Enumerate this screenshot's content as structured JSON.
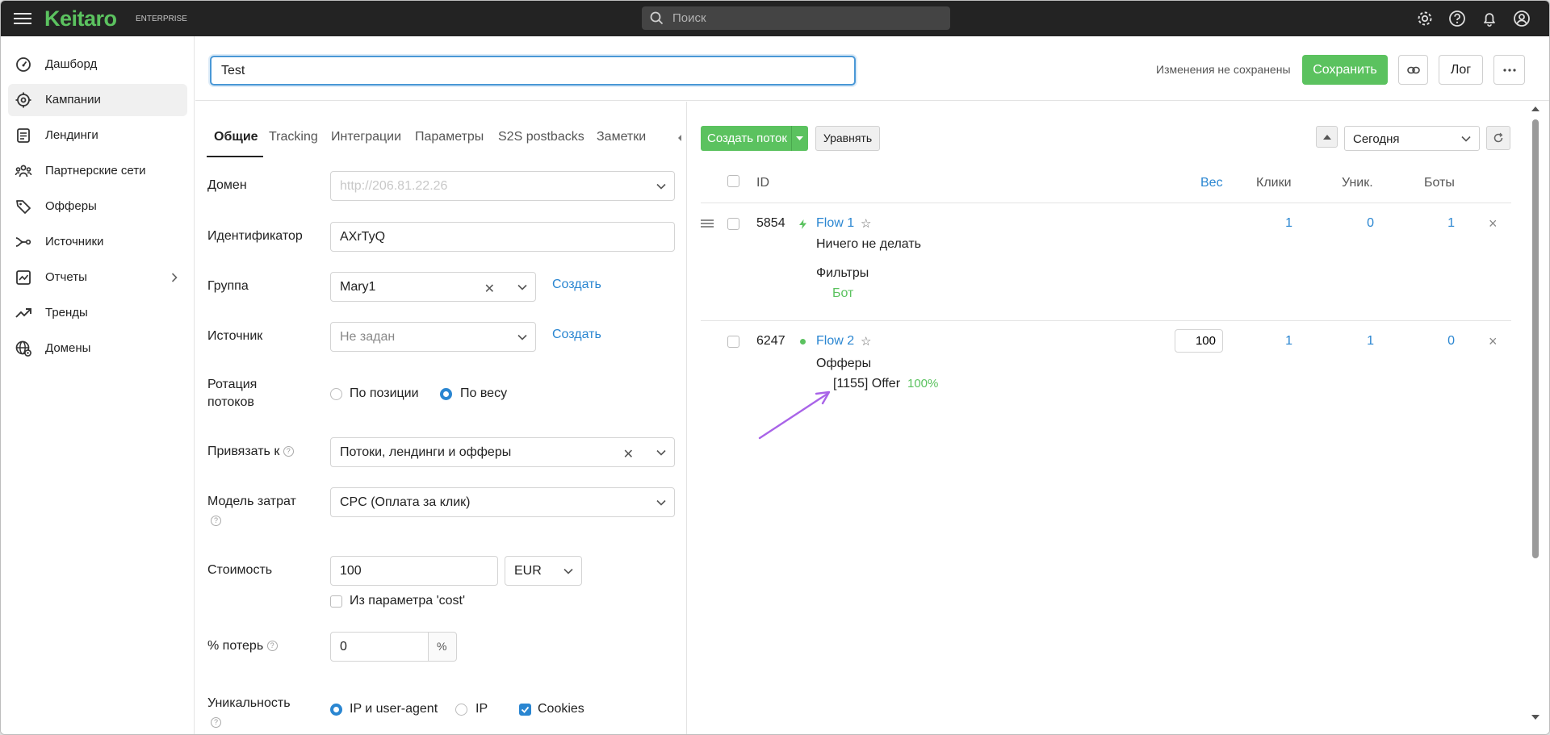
{
  "header": {
    "brand": "Keitaro",
    "edition": "ENTERPRISE",
    "search_placeholder": "Поиск"
  },
  "sidebar": {
    "items": [
      {
        "label": "Дашборд",
        "icon": "dashboard-icon"
      },
      {
        "label": "Кампании",
        "icon": "campaigns-icon",
        "active": true
      },
      {
        "label": "Лендинги",
        "icon": "landings-icon"
      },
      {
        "label": "Партнерские сети",
        "icon": "affiliate-networks-icon"
      },
      {
        "label": "Офферы",
        "icon": "offers-icon"
      },
      {
        "label": "Источники",
        "icon": "sources-icon"
      },
      {
        "label": "Отчеты",
        "icon": "reports-icon"
      },
      {
        "label": "Тренды",
        "icon": "trends-icon"
      },
      {
        "label": "Домены",
        "icon": "domains-icon"
      }
    ]
  },
  "campaign": {
    "name": "Test",
    "unsaved_text": "Изменения не сохранены",
    "save_label": "Сохранить",
    "log_label": "Лог"
  },
  "tabs": [
    "Общие",
    "Tracking",
    "Интеграции",
    "Параметры",
    "S2S postbacks",
    "Заметки"
  ],
  "form": {
    "domain_label": "Домен",
    "domain_value": "http://206.81.22.26",
    "identifier_label": "Идентификатор",
    "identifier_value": "AXrTyQ",
    "group_label": "Группа",
    "group_value": "Mary1",
    "create_label": "Создать",
    "source_label": "Источник",
    "source_placeholder": "Не задан",
    "rotation_label_1": "Ротация",
    "rotation_label_2": "потоков",
    "rotation_opt_position": "По позиции",
    "rotation_opt_weight": "По весу",
    "bind_label": "Привязать к",
    "bind_value": "Потоки, лендинги и офферы",
    "cost_model_label": "Модель затрат",
    "cost_model_value": "CPC (Оплата за клик)",
    "cost_label": "Стоимость",
    "cost_value": "100",
    "currency_value": "EUR",
    "cost_param_label": "Из параметра 'cost'",
    "loss_label": "% потерь",
    "loss_value": "0",
    "loss_unit": "%",
    "unique_label": "Уникальность",
    "unique_opt_ip_ua": "IP и user-agent",
    "unique_opt_ip": "IP",
    "unique_opt_cookies": "Cookies"
  },
  "flows_panel": {
    "create_flow_label": "Создать поток",
    "align_label": "Уравнять",
    "date_range": "Сегодня",
    "columns": {
      "id": "ID",
      "weight": "Вес",
      "clicks": "Клики",
      "unique": "Уник.",
      "bots": "Боты"
    },
    "flows": [
      {
        "id": "5854",
        "name": "Flow 1",
        "action": "Ничего не делать",
        "filters_label": "Фильтры",
        "filter": "Бот",
        "clicks": "1",
        "unique": "0",
        "bots": "1"
      },
      {
        "id": "6247",
        "name": "Flow 2",
        "weight": "100",
        "offers_label": "Офферы",
        "offer": "[1155] Offer",
        "offer_share": "100%",
        "clicks": "1",
        "unique": "1",
        "bots": "0"
      }
    ]
  },
  "colors": {
    "brand_green": "#5bc25f",
    "link_blue": "#2a86d1",
    "focus_blue": "#4a98d6",
    "annotation_arrow": "#a964e8",
    "topbar": "#232323"
  }
}
